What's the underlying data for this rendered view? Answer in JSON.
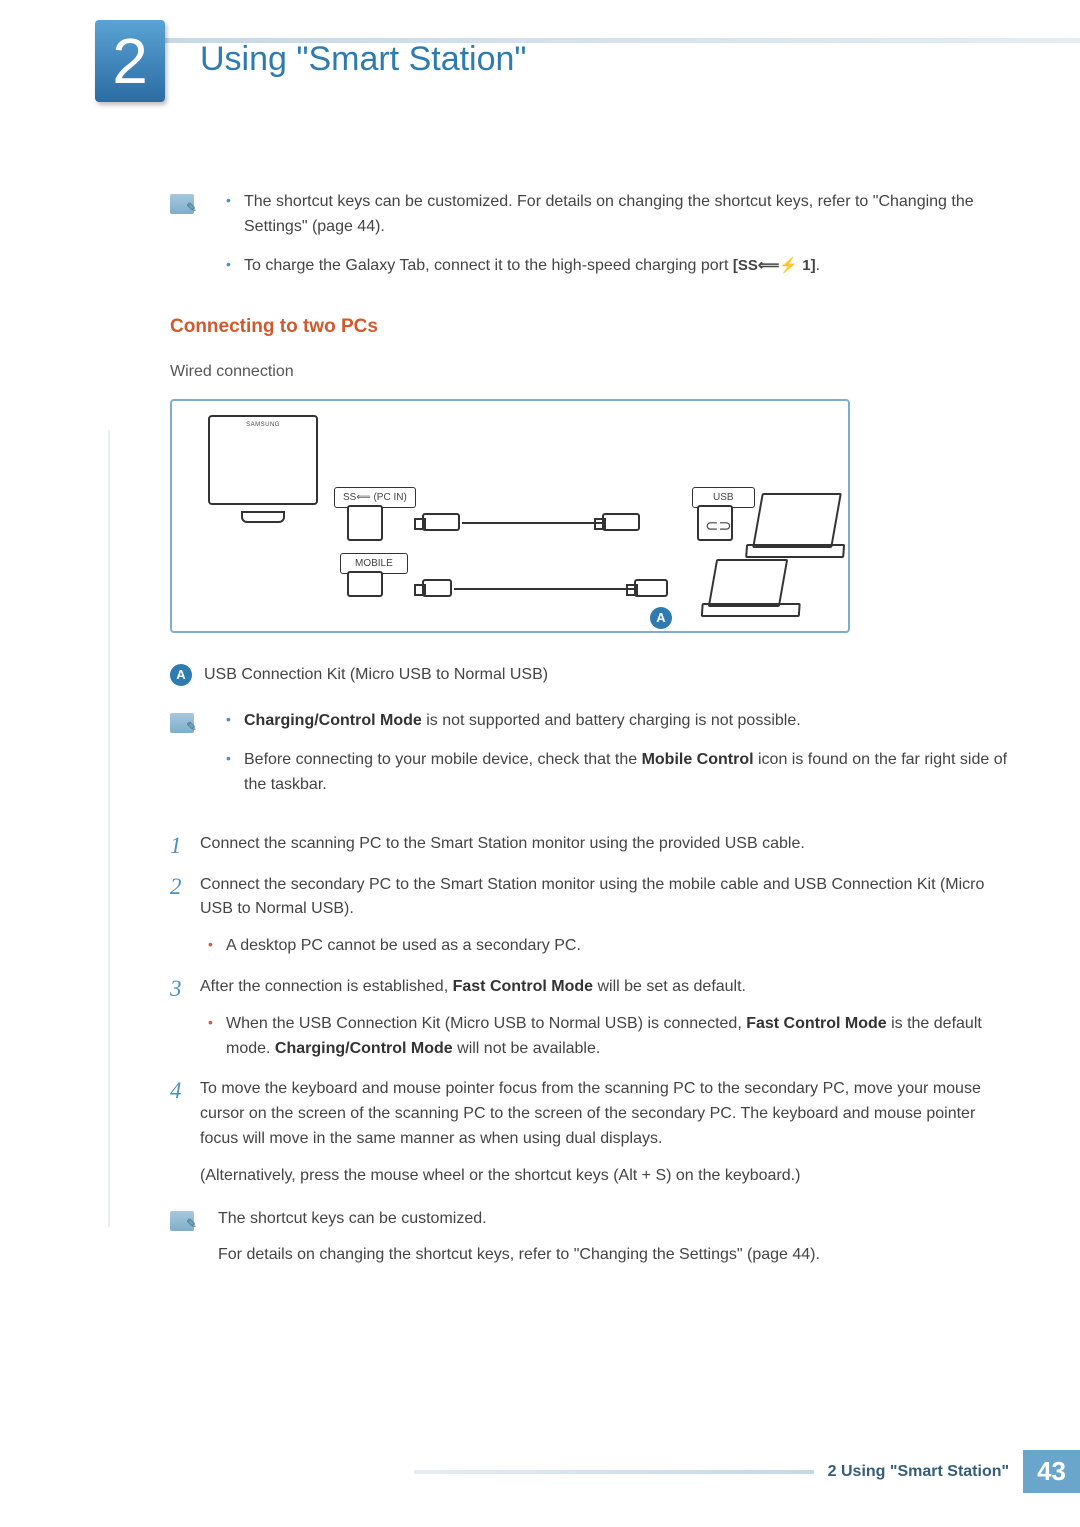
{
  "chapter": {
    "number": "2",
    "title": "Using \"Smart Station\""
  },
  "top_notes": [
    "The shortcut keys can be customized. For details on changing the shortcut keys, refer to \"Changing the Settings\" (page 44).",
    "To charge the Galaxy Tab, connect it to the high-speed charging port "
  ],
  "charging_port_symbol": "[SS⟸⚡ 1]",
  "section_heading": "Connecting to two PCs",
  "sub_heading": "Wired connection",
  "diagram_labels": {
    "pc_in": "SS⟸ (PC  IN)",
    "mobile": "MOBILE",
    "usb": "USB",
    "marker": "A"
  },
  "legend_a": "USB Connection Kit (Micro USB to Normal USB)",
  "mid_notes": {
    "bold1": "Charging/Control Mode",
    "line1_rest": " is not supported and battery charging is not possible.",
    "line2_a": "Before connecting to your mobile device, check that the ",
    "bold2": "Mobile Control",
    "line2_b": " icon is found on the far right side of the taskbar."
  },
  "steps": {
    "s1": "Connect the scanning PC to the Smart Station monitor using the provided USB cable.",
    "s2_a": "Connect the secondary PC to the Smart Station monitor using the mobile cable and USB Connection Kit (Micro USB to Normal USB).",
    "s2_sub": "A desktop PC cannot be used as a secondary PC.",
    "s3_a": "After the connection is established, ",
    "s3_bold": "Fast Control Mode",
    "s3_b": " will be set as default.",
    "s3_sub_a": "When the USB Connection Kit (Micro USB to Normal USB) is connected, ",
    "s3_sub_bold1": "Fast Control Mode",
    "s3_sub_b": " is the default mode. ",
    "s3_sub_bold2": "Charging/Control Mode",
    "s3_sub_c": " will not be available.",
    "s4_a": "To move the keyboard and mouse pointer focus from the scanning PC to the secondary PC, move your mouse cursor on the screen of the scanning PC to the screen of the secondary PC. The keyboard and mouse pointer focus will move in the same manner as when using dual displays.",
    "s4_b": "(Alternatively, press the mouse wheel or the shortcut keys (Alt + S) on the keyboard.)"
  },
  "bottom_notes": {
    "line1": "The shortcut keys can be customized.",
    "line2": "For details on changing the shortcut keys, refer to \"Changing the Settings\" (page 44)."
  },
  "footer": {
    "text": "2 Using \"Smart Station\"",
    "page": "43"
  }
}
